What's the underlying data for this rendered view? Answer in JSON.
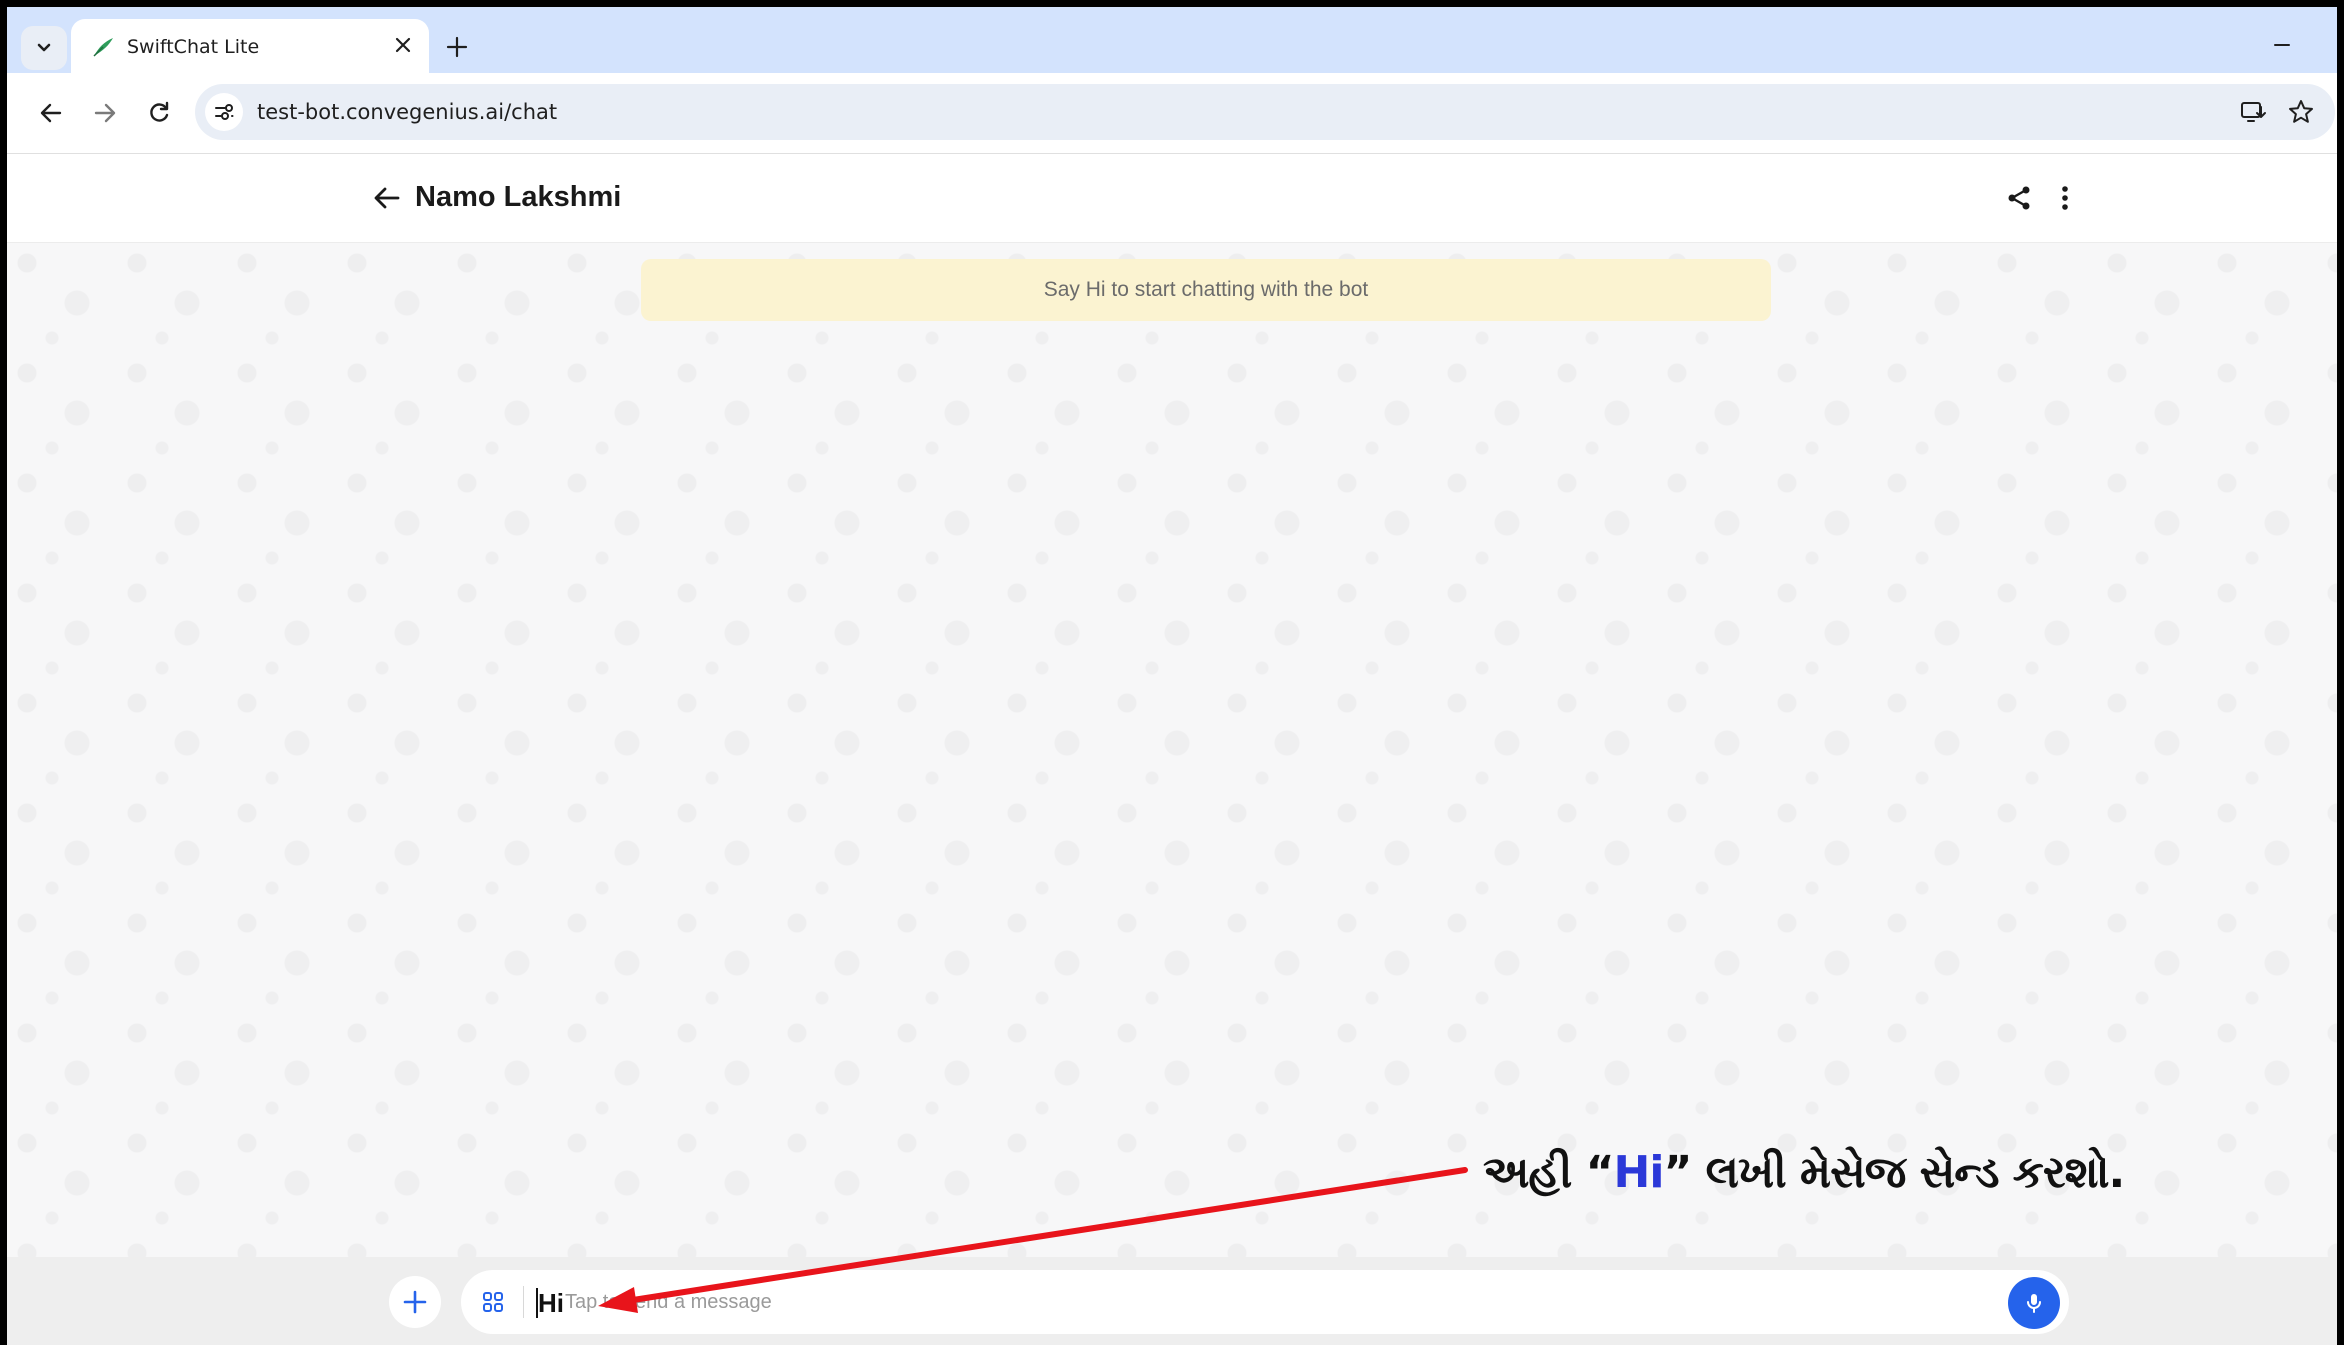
{
  "browser": {
    "tab_title": "SwiftChat Lite",
    "url": "test-bot.convegenius.ai/chat"
  },
  "chat": {
    "bot_name": "Namo Lakshmi",
    "banner_text": "Say Hi to start chatting with the bot"
  },
  "composer": {
    "typed_value": "Hi",
    "placeholder": "Tap to send a message"
  },
  "annotation": {
    "prefix": "અહી “",
    "highlight": "Hi",
    "suffix": "” લખી મેસેજ સેન્ડ કરશો."
  },
  "colors": {
    "accent": "#2563eb",
    "banner_bg": "#fbf3d1",
    "arrow": "#e8141b",
    "tab_strip": "#d3e3fd",
    "annotation_highlight": "#2b38d8"
  },
  "icons": {
    "tab_search": "chevron-down-icon",
    "favicon": "swiftchat-leaf-icon",
    "tab_close": "close-icon",
    "new_tab": "plus-icon",
    "back": "arrow-left-icon",
    "forward": "arrow-right-icon",
    "reload": "reload-icon",
    "site_info": "tune-icon",
    "install": "install-app-icon",
    "bookmark": "star-icon",
    "chat_back": "arrow-left-icon",
    "share": "share-icon",
    "more": "more-vertical-icon",
    "attach": "plus-icon",
    "apps": "grid-icon",
    "mic": "microphone-icon"
  }
}
